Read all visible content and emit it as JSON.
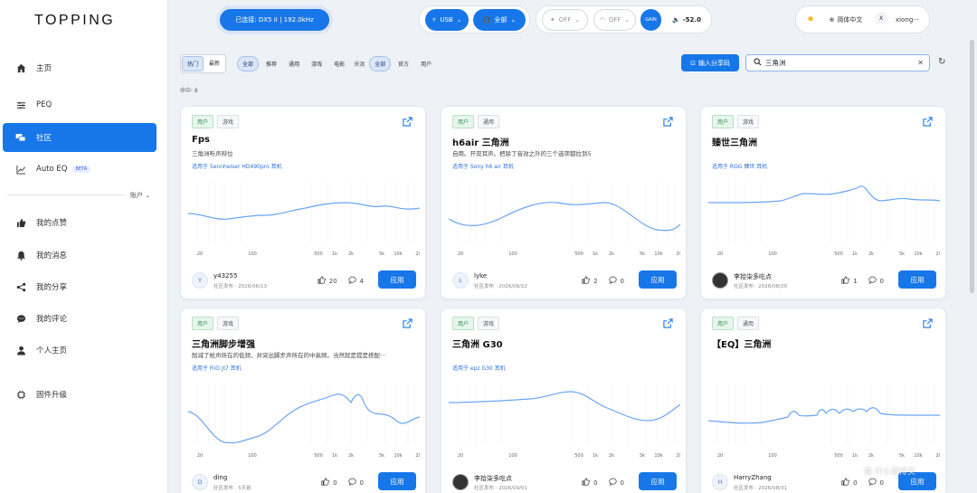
{
  "brand": {
    "logo_text": "TOPPING"
  },
  "sidebar": {
    "items": [
      {
        "label": "主页",
        "icon": "home-icon"
      },
      {
        "label": "PEQ",
        "icon": "equalizer-icon"
      },
      {
        "label": "社区",
        "icon": "community-icon",
        "active": true
      },
      {
        "label": "Auto EQ",
        "icon": "chart-icon",
        "badge": "BETA"
      }
    ],
    "account_label": "账户",
    "account_items": [
      {
        "label": "我的点赞",
        "icon": "thumbs-up-icon"
      },
      {
        "label": "我的消息",
        "icon": "bell-icon"
      },
      {
        "label": "我的分享",
        "icon": "share-icon"
      },
      {
        "label": "我的评论",
        "icon": "comment-icon"
      },
      {
        "label": "个人主页",
        "icon": "user-icon"
      },
      {
        "label": "固件升级",
        "icon": "firmware-icon"
      }
    ]
  },
  "topbar": {
    "connection": "已连接: DX5 II | 192.0kHz",
    "output": "USB",
    "headphone_mode": "全部",
    "toggle_a": "OFF",
    "toggle_b": "OFF",
    "gain": "GAIN",
    "volume": "-52.0",
    "language": "简体中文",
    "user_initial": "X",
    "username": "xiong···"
  },
  "filters": {
    "sort": [
      "热门",
      "最新"
    ],
    "category": [
      "全部",
      "推荐",
      "通用",
      "游戏",
      "电影"
    ],
    "source_label": "来源",
    "source": [
      "全部",
      "官方",
      "用户"
    ]
  },
  "import_button": "输入分享码",
  "search": {
    "value": "三角洲"
  },
  "hits": "命中: 8",
  "axis_ticks": [
    "20",
    "100",
    "500",
    "1k",
    "2k",
    "5k",
    "10k",
    "20k"
  ],
  "cards": [
    {
      "tags": [
        "用户",
        "游戏"
      ],
      "title": "Fps",
      "desc": "三角洲听声辩位",
      "fit": "适用于 Sennheiser HD490pro 耳机",
      "user": "y43255",
      "initial": "Y",
      "meta": "社区发布 · 2026/06/13",
      "likes": "20",
      "comments": "4",
      "apply": "应用"
    },
    {
      "tags": [
        "用户",
        "通用"
      ],
      "title": "h6air 三角洲",
      "desc": "自用。开双耳声。把除了音效之外的三个选项都拉到5",
      "fit": "适用于 Sony h6 air 耳机",
      "user": "lyke",
      "initial": "L",
      "meta": "社区发布 · 2026/08/22",
      "likes": "2",
      "comments": "0",
      "apply": "应用"
    },
    {
      "tags": [
        "用户",
        "游戏"
      ],
      "title": "臻世三角洲",
      "desc": "",
      "fit": "适用于 ROG 臻世 耳机",
      "user": "李拾柒多吃点",
      "initial": "",
      "meta": "社区发布 · 2026/08/29",
      "likes": "1",
      "comments": "0",
      "apply": "应用"
    },
    {
      "tags": [
        "用户",
        "游戏"
      ],
      "title": "三角洲脚步增强",
      "desc": "削减了枪声所在的低频，并突出脚步声所在的中高频。当然就是提是搭配···",
      "fit": "适用于 FiiO jt7 耳机",
      "user": "ding",
      "initial": "D",
      "meta": "社区发布 · 5天前",
      "likes": "0",
      "comments": "0",
      "apply": "应用"
    },
    {
      "tags": [
        "用户",
        "游戏"
      ],
      "title": "三角洲 G30",
      "desc": "",
      "fit": "适用于 epz G30 耳机",
      "user": "李拾柒多吃点",
      "initial": "",
      "meta": "社区发布 · 2026/09/01",
      "likes": "0",
      "comments": "0",
      "apply": "应用"
    },
    {
      "tags": [
        "用户",
        "通用"
      ],
      "title": "【EQ】三角洲",
      "desc": "",
      "fit": "",
      "user": "HarryZhang",
      "initial": "H",
      "meta": "社区发布 · 2026/08/31",
      "likes": "0",
      "comments": "0",
      "apply": "应用"
    }
  ],
  "watermark": "值 什么值得买"
}
